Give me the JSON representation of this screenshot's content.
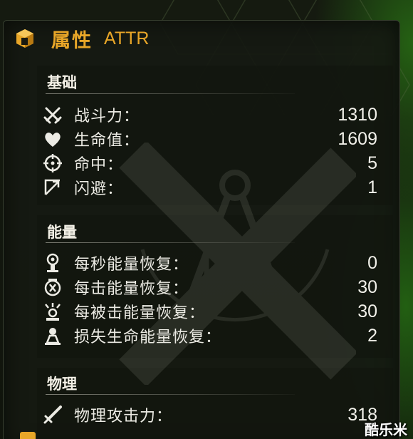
{
  "header": {
    "title": "属性",
    "subtitle": "ATTR",
    "icon": "cube-icon",
    "accent": "#e8a628"
  },
  "sections": [
    {
      "title": "基础",
      "rows": [
        {
          "icon": "crossed-swords-icon",
          "label": "战斗力：",
          "value": "1310"
        },
        {
          "icon": "heart-icon",
          "label": "生命值：",
          "value": "1609"
        },
        {
          "icon": "crosshair-icon",
          "label": "命中：",
          "value": "5"
        },
        {
          "icon": "dodge-arrow-icon",
          "label": "闪避：",
          "value": "1"
        }
      ]
    },
    {
      "title": "能量",
      "rows": [
        {
          "icon": "energy-per-second-icon",
          "label": "每秒能量恢复：",
          "value": "0"
        },
        {
          "icon": "energy-per-hit-icon",
          "label": "每击能量恢复：",
          "value": "30"
        },
        {
          "icon": "energy-when-hit-icon",
          "label": "每被击能量恢复：",
          "value": "30"
        },
        {
          "icon": "energy-per-hp-lost-icon",
          "label": "损失生命能量恢复：",
          "value": "2"
        }
      ]
    },
    {
      "title": "物理",
      "rows": [
        {
          "icon": "sword-icon",
          "label": "物理攻击力：",
          "value": "318"
        }
      ]
    }
  ],
  "watermark": "酷乐米"
}
